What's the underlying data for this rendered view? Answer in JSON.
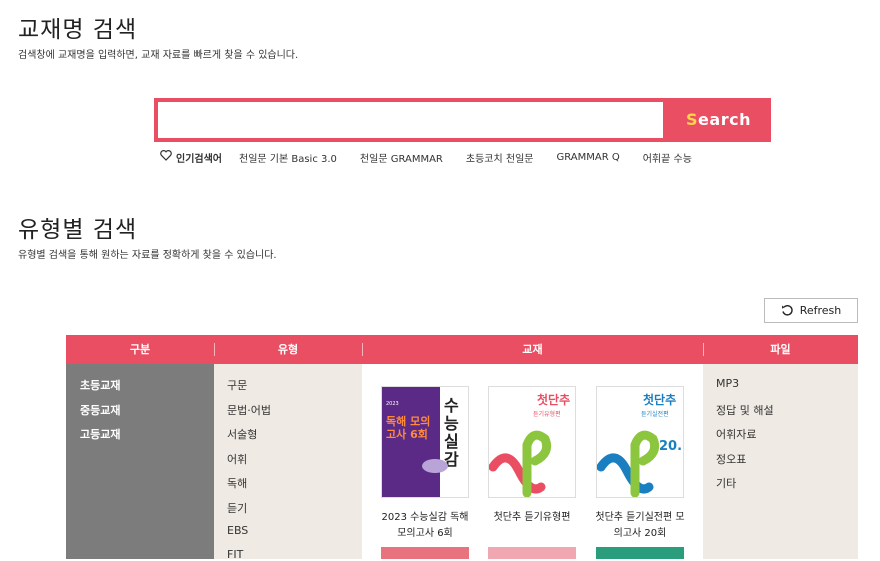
{
  "section1": {
    "title": "교재명 검색",
    "desc": "검색창에 교재명을 입력하면, 교재 자료를 빠르게 찾을 수 있습니다."
  },
  "search": {
    "placeholder": "",
    "value": "",
    "button_first": "S",
    "button_rest": "earch"
  },
  "popular": {
    "label": "인기검색어",
    "keywords": [
      "천일문 기본 Basic 3.0",
      "천일문 GRAMMAR",
      "초등코치 천일문",
      "GRAMMAR Q",
      "어휘끝 수능"
    ]
  },
  "section2": {
    "title": "유형별 검색",
    "desc": "유형별 검색을 통해 원하는 자료를 정확하게 찾을 수 있습니다."
  },
  "refresh_label": "Refresh",
  "table": {
    "headers": [
      "구분",
      "유형",
      "교재",
      "파일"
    ],
    "categories": [
      "초등교재",
      "중등교재",
      "고등교재"
    ],
    "types": [
      "구문",
      "문법·어법",
      "서술형",
      "어휘",
      "독해",
      "듣기",
      "EBS",
      "FIT"
    ],
    "books": [
      {
        "title_line1": "2023 수능실감 독해",
        "title_line2": "모의고사 6회",
        "cover_year": "2023",
        "cover_main": "수능실감",
        "cover_sub": "독해 모의고사 6회"
      },
      {
        "title_line1": "첫단추 듣기유형편",
        "title_line2": "",
        "cover_main": "첫단추",
        "cover_sub": "듣기유형편"
      },
      {
        "title_line1": "첫단추 듣기실전편 모",
        "title_line2": "의고사 20회",
        "cover_main": "첫단추",
        "cover_sub": "듣기실전편",
        "cover_num": "20."
      }
    ],
    "files": [
      "MP3",
      "정답 및 해설",
      "어휘자료",
      "정오표",
      "기타"
    ]
  },
  "colors": {
    "accent": "#e94e63",
    "category_bg": "#7c7c7c",
    "panel_bg": "#efeae3"
  }
}
